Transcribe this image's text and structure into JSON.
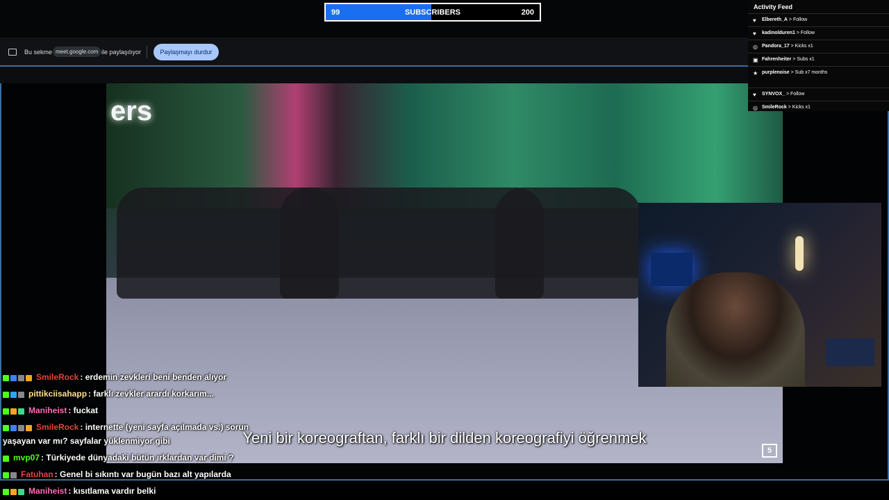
{
  "sub_goal": {
    "current": "99",
    "label": "SUBSCRIBERS",
    "goal": "200",
    "progress": 0.495
  },
  "share_bar": {
    "text_before": "Bu sekme",
    "domain": "meet.google.com",
    "text_after": "ile paylaşılıyor",
    "stop_button": "Paylaşmayı durdur"
  },
  "video": {
    "neon_sign": "ers",
    "subtitle": "Yeni bir koreograftan, farklı bir dilden koreografiyi öğrenmek",
    "channel_logo": "5"
  },
  "activity_feed": {
    "title": "Activity Feed",
    "items": [
      {
        "icon": "heart-icon",
        "glyph": "♥",
        "user": "Elbereth_A",
        "action": " > Follow"
      },
      {
        "icon": "heart-icon",
        "glyph": "♥",
        "user": "kadinolduren1",
        "action": " > Follow"
      },
      {
        "icon": "kick-icon",
        "glyph": "◎",
        "user": "Pandora_17",
        "action": " > Kicks x1"
      },
      {
        "icon": "sub-icon",
        "glyph": "▣",
        "user": "Fahrenheiter",
        "action": " > Subs x1"
      },
      {
        "icon": "star-icon",
        "glyph": "★",
        "user": "purplenoise",
        "action": " > Sub x7 months"
      },
      {
        "icon": "heart-icon",
        "glyph": "♥",
        "user": "SYNVOX_",
        "action": " > Follow"
      },
      {
        "icon": "kick-icon",
        "glyph": "◎",
        "user": "SmileRock",
        "action": " > Kicks x1"
      }
    ]
  },
  "chat": [
    {
      "user": "SmileRock",
      "color": "#e0473e",
      "text": ": erdemin zevkleri beni benden alıyor",
      "badges": [
        "#53fc18",
        "#3b82f6",
        "#888888",
        "#f5a623"
      ]
    },
    {
      "user": "pittikciisahapp",
      "color": "#ffe08a",
      "text": ": farklı zevkler arardı korkarım...",
      "badges": [
        "#53fc18",
        "#2ea3f2",
        "#888888"
      ]
    },
    {
      "user": "Maniheist",
      "color": "#ff6ab5",
      "text": ": fuckat",
      "badges": [
        "#53fc18",
        "#f5a623",
        "#3ddc84"
      ]
    },
    {
      "user": "SmileRock",
      "color": "#e0473e",
      "text": ": internette (yeni sayfa açılmada vs.) sorun",
      "badges": [
        "#53fc18",
        "#3b82f6",
        "#888888",
        "#f5a623"
      ]
    },
    {
      "user": "",
      "color": "#ffffff",
      "text": "yaşayan var mı? sayfalar yüklenmiyor gibi",
      "badges": []
    },
    {
      "user": "mvp07",
      "color": "#53fc18",
      "text": ": Türkiyede dünyadaki bütün ırklardan var dimi ?",
      "badges": [
        "#53fc18"
      ]
    },
    {
      "user": "Fatuhan",
      "color": "#e0473e",
      "text": ": Genel bi sıkıntı var bugün bazı alt yapılarda",
      "badges": [
        "#53fc18",
        "#888888"
      ]
    },
    {
      "user": "Maniheist",
      "color": "#ff6ab5",
      "text": ": kısıtlama vardır belki",
      "badges": [
        "#53fc18",
        "#f5a623",
        "#3ddc84"
      ]
    }
  ]
}
